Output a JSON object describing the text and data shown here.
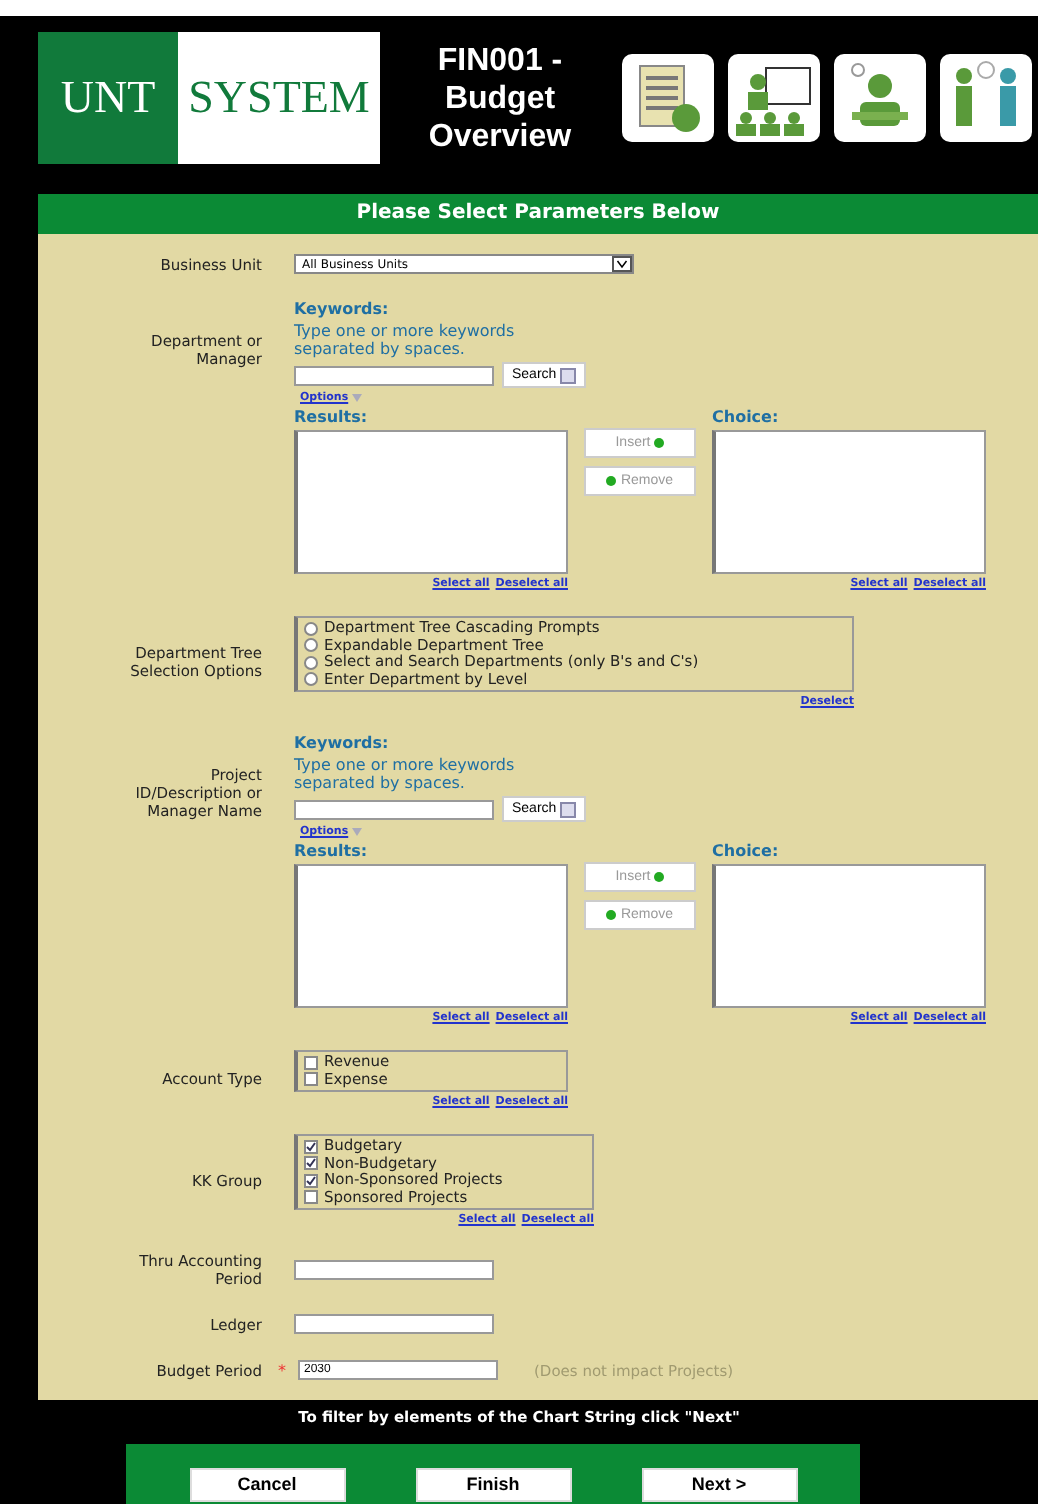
{
  "header": {
    "logo": {
      "left": "UNT",
      "right": "SYSTEM"
    },
    "title": "FIN001 - Budget Overview"
  },
  "panel": {
    "title": "Please Select Parameters Below",
    "fields": [
      {
        "kind": "select",
        "label": "Business Unit",
        "value": "All Business Units"
      },
      {
        "kind": "picker",
        "label": "Department or Manager",
        "keywords_heading": "Keywords:",
        "keywords_hint": "Type one or more keywords separated by spaces.",
        "search_button": "Search",
        "options_link": "Options",
        "results_label": "Results:",
        "choice_label": "Choice:",
        "insert_button": "Insert",
        "remove_button": "Remove",
        "results_links": [
          "Select all",
          "Deselect all"
        ],
        "choice_links": [
          "Select all",
          "Deselect all"
        ]
      },
      {
        "kind": "radios",
        "label": "Department Tree Selection Options",
        "options": [
          {
            "label": "Department Tree Cascading Prompts",
            "selected": false
          },
          {
            "label": "Expandable Department Tree",
            "selected": false
          },
          {
            "label": "Select and Search Departments (only B's and C's)",
            "selected": false
          },
          {
            "label": "Enter Department by Level",
            "selected": false
          }
        ],
        "links": [
          "Deselect"
        ]
      },
      {
        "kind": "picker",
        "label": "Project ID/Description or Manager Name",
        "keywords_heading": "Keywords:",
        "keywords_hint": "Type one or more keywords separated by spaces.",
        "search_button": "Search",
        "options_link": "Options",
        "results_label": "Results:",
        "choice_label": "Choice:",
        "insert_button": "Insert",
        "remove_button": "Remove",
        "results_links": [
          "Select all",
          "Deselect all"
        ],
        "choice_links": [
          "Select all",
          "Deselect all"
        ]
      },
      {
        "kind": "checks",
        "label": "Account Type",
        "options": [
          {
            "label": "Revenue",
            "checked": false
          },
          {
            "label": "Expense",
            "checked": false
          }
        ],
        "links": [
          "Select all",
          "Deselect all"
        ]
      },
      {
        "kind": "checks",
        "label": "KK Group",
        "options": [
          {
            "label": "Budgetary",
            "checked": true
          },
          {
            "label": "Non-Budgetary",
            "checked": true
          },
          {
            "label": "Non-Sponsored Projects",
            "checked": true
          },
          {
            "label": "Sponsored Projects",
            "checked": false
          }
        ],
        "links": [
          "Select all",
          "Deselect all"
        ]
      },
      {
        "kind": "text",
        "label": "Thru Accounting Period"
      },
      {
        "kind": "text",
        "label": "Ledger"
      },
      {
        "kind": "text",
        "label": "Budget Period",
        "required_mark": "*",
        "value": "2030",
        "note": "(Does not impact Projects)"
      }
    ]
  },
  "footer": {
    "hint": "To filter by elements of the Chart String click \"Next\"",
    "buttons": [
      "Cancel",
      "Finish",
      "Next >"
    ]
  }
}
